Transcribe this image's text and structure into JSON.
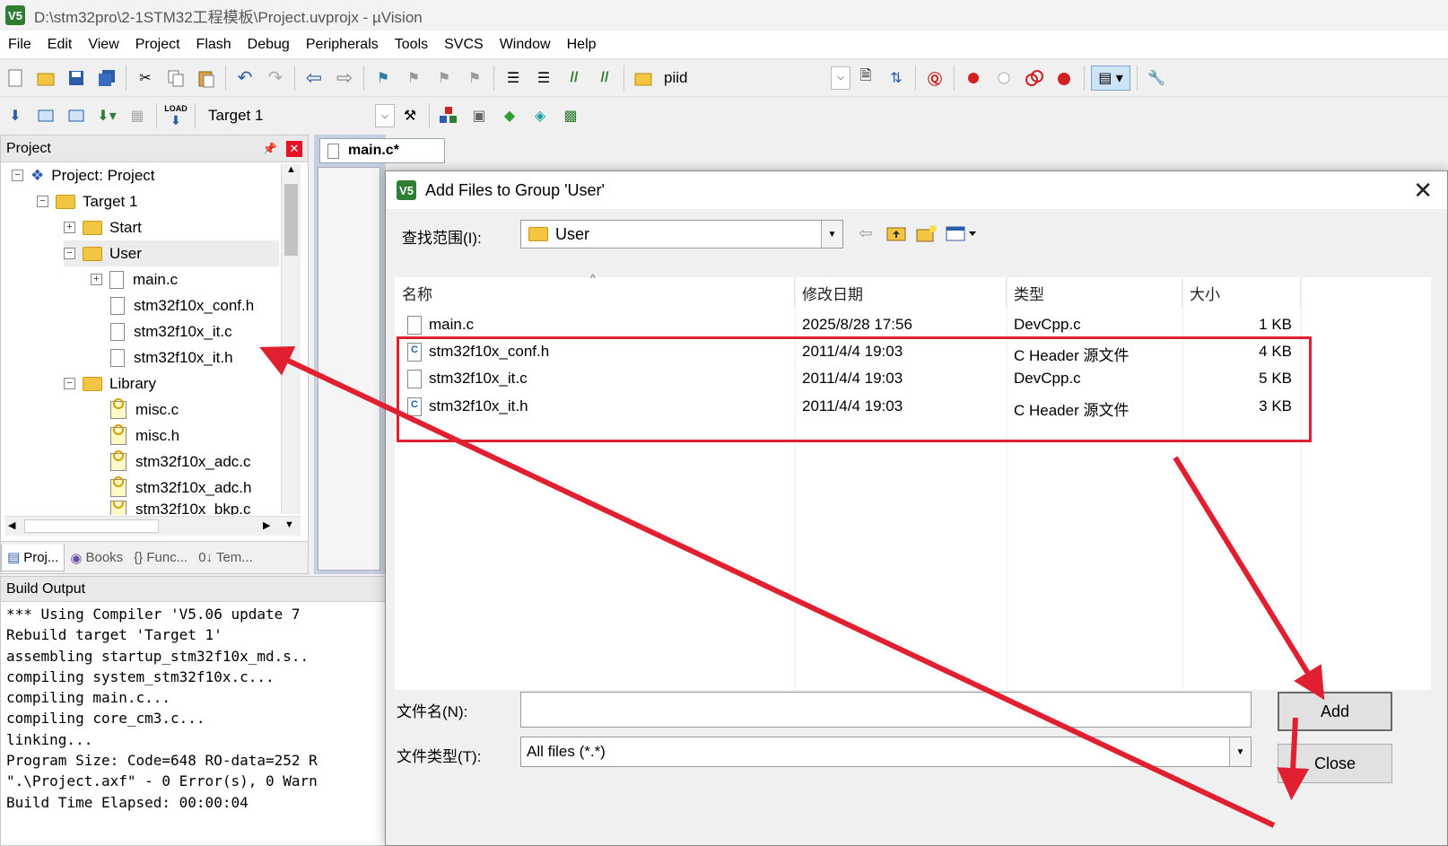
{
  "window": {
    "title": "D:\\stm32pro\\2-1STM32工程模板\\Project.uvprojx - µVision",
    "app_icon": "V5"
  },
  "menu": [
    "File",
    "Edit",
    "View",
    "Project",
    "Flash",
    "Debug",
    "Peripherals",
    "Tools",
    "SVCS",
    "Window",
    "Help"
  ],
  "toolbar1": {
    "find_value": "piid"
  },
  "toolbar2": {
    "target_value": "Target 1",
    "load_label": "LOAD"
  },
  "project_panel": {
    "title": "Project",
    "pin": "ᴖ",
    "close": "✕",
    "tree": [
      {
        "label": "Project: Project",
        "toggle": "⊟"
      },
      {
        "label": "Target 1",
        "toggle": "⊟"
      },
      {
        "label": "Start",
        "toggle": "⊞"
      },
      {
        "label": "User",
        "toggle": "⊟"
      },
      {
        "label": "main.c",
        "toggle": "⊞"
      },
      {
        "label": "stm32f10x_conf.h"
      },
      {
        "label": "stm32f10x_it.c"
      },
      {
        "label": "stm32f10x_it.h"
      },
      {
        "label": "Library",
        "toggle": "⊟"
      },
      {
        "label": "misc.c"
      },
      {
        "label": "misc.h"
      },
      {
        "label": "stm32f10x_adc.c"
      },
      {
        "label": "stm32f10x_adc.h"
      },
      {
        "label": "stm32f10x_bkp.c"
      }
    ],
    "tabs": [
      "Proj...",
      "Books",
      "{} Func...",
      "0↓ Tem..."
    ]
  },
  "editor": {
    "tab_label": "main.c*"
  },
  "build_output": {
    "title": "Build Output",
    "lines": [
      "*** Using Compiler 'V5.06 update 7",
      "Rebuild target 'Target 1'",
      "assembling startup_stm32f10x_md.s..",
      "compiling system_stm32f10x.c...",
      "compiling main.c...",
      "compiling core_cm3.c...",
      "linking...",
      "Program Size: Code=648 RO-data=252 R",
      "\".\\Project.axf\" - 0 Error(s), 0 Warn",
      "Build Time Elapsed:  00:00:04"
    ]
  },
  "dialog": {
    "title": "Add Files to Group 'User'",
    "close": "✕",
    "lookin_label": "查找范围(I):",
    "lookin_value": "User",
    "columns": [
      "名称",
      "修改日期",
      "类型",
      "大小"
    ],
    "files": [
      {
        "name": "main.c",
        "date": "2025/8/28 17:56",
        "type": "DevCpp.c",
        "size": "1 KB",
        "icon": "file"
      },
      {
        "name": "stm32f10x_conf.h",
        "date": "2011/4/4 19:03",
        "type": "C Header 源文件",
        "size": "4 KB",
        "icon": "c-header"
      },
      {
        "name": "stm32f10x_it.c",
        "date": "2011/4/4 19:03",
        "type": "DevCpp.c",
        "size": "5 KB",
        "icon": "file"
      },
      {
        "name": "stm32f10x_it.h",
        "date": "2011/4/4 19:03",
        "type": "C Header 源文件",
        "size": "3 KB",
        "icon": "c-header"
      }
    ],
    "filename_label": "文件名(N):",
    "filename_value": "",
    "filetype_label": "文件类型(T):",
    "filetype_value": "All files (*.*)",
    "add_button": "Add",
    "close_button": "Close"
  },
  "colors": {
    "annotation_red": "#e02030",
    "folder_yellow": "#f4c542",
    "uvision_green": "#2e7d32"
  }
}
